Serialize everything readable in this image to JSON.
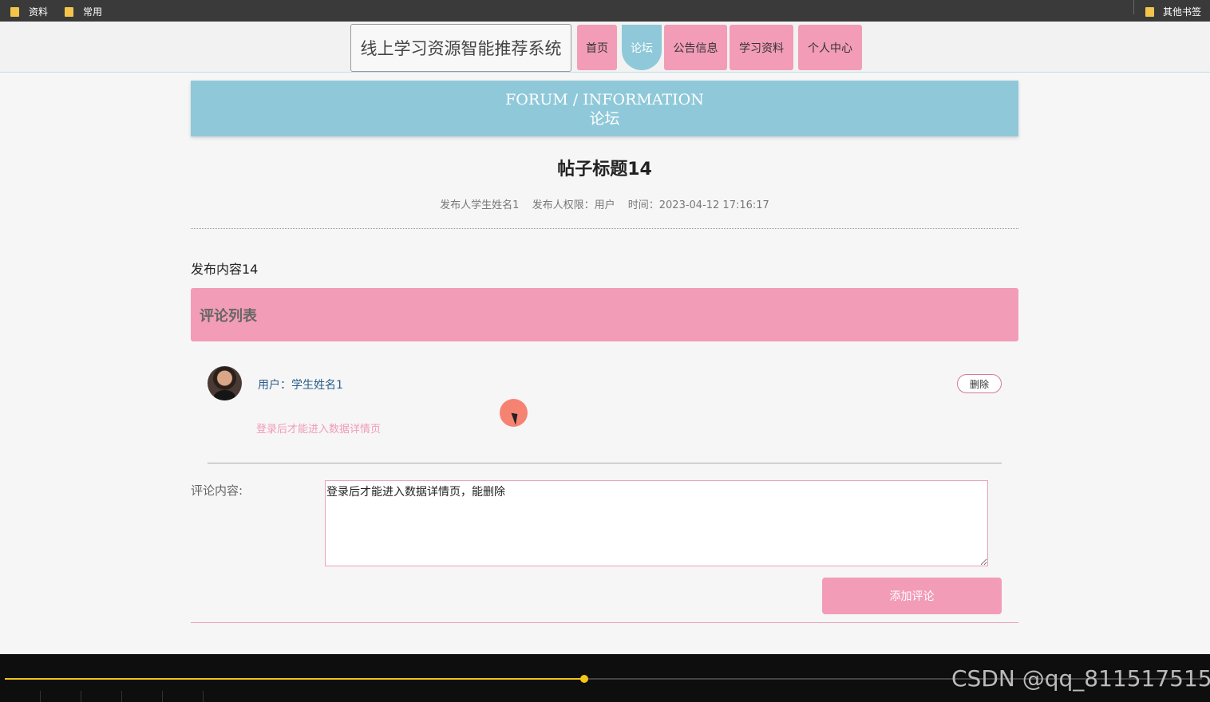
{
  "bookmarks": {
    "items": [
      "资料",
      "常用"
    ],
    "other": "其他书签"
  },
  "header": {
    "site_title": "线上学习资源智能推荐系统",
    "nav": [
      {
        "label": "首页",
        "active": false
      },
      {
        "label": "论坛",
        "active": true
      },
      {
        "label": "公告信息",
        "active": false
      },
      {
        "label": "学习资料",
        "active": false
      },
      {
        "label": "个人中心",
        "active": false
      }
    ]
  },
  "banner": {
    "en": "FORUM / INFORMATION",
    "cn": "论坛"
  },
  "post": {
    "title": "帖子标题14",
    "author": "发布人学生姓名1",
    "role": "发布人权限：用户",
    "time": "时间：2023-04-12 17:16:17",
    "content": "发布内容14"
  },
  "comments": {
    "header": "评论列表",
    "items": [
      {
        "user": "用户：学生姓名1",
        "delete_label": "删除",
        "text": "登录后才能进入数据详情页"
      }
    ]
  },
  "form": {
    "label": "评论内容:",
    "value": "登录后才能进入数据详情页，能删除",
    "submit_label": "添加评论"
  },
  "player": {
    "progress_fraction": 0.484,
    "watermark": "CSDN @qq_811517515"
  },
  "colors": {
    "accent_pink": "#f29cb8",
    "accent_blue": "#8fc9d9"
  }
}
